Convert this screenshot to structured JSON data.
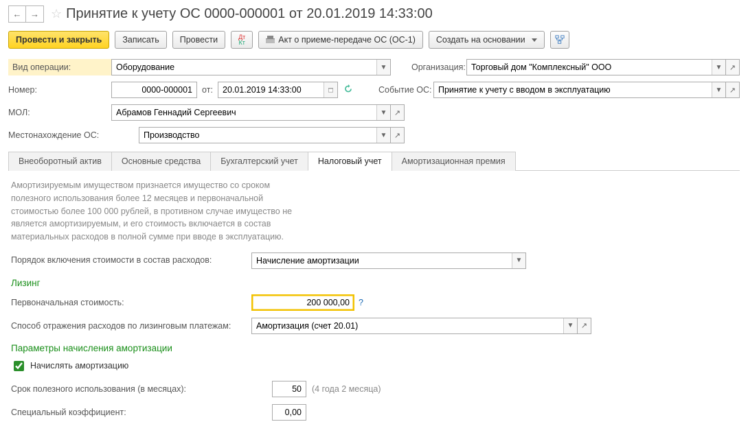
{
  "header": {
    "title": "Принятие к учету ОС 0000-000001 от 20.01.2019 14:33:00"
  },
  "toolbar": {
    "post_close": "Провести и закрыть",
    "save": "Записать",
    "post": "Провести",
    "act": "Акт о приеме-передаче ОС (ОС-1)",
    "create_based": "Создать на основании"
  },
  "form": {
    "op_type_label": "Вид операции:",
    "op_type_value": "Оборудование",
    "org_label": "Организация:",
    "org_value": "Торговый дом \"Комплексный\" ООО",
    "num_label": "Номер:",
    "num_value": "0000-000001",
    "date_label": "от:",
    "date_value": "20.01.2019 14:33:00",
    "event_label": "Событие ОС:",
    "event_value": "Принятие к учету с вводом в эксплуатацию",
    "mol_label": "МОЛ:",
    "mol_value": "Абрамов Геннадий Сергеевич",
    "loc_label": "Местонахождение ОС:",
    "loc_value": "Производство"
  },
  "tabs": {
    "t1": "Внеоборотный актив",
    "t2": "Основные средства",
    "t3": "Бухгалтерский учет",
    "t4": "Налоговый учет",
    "t5": "Амортизационная премия"
  },
  "tax": {
    "info": "Амортизируемым имуществом признается имущество со сроком полезного использования более 12 месяцев и первоначальной стоимостью более 100 000 рублей, в противном случае имущество не является амортизируемым, и его стоимость включается в состав материальных расходов в полной сумме при вводе в эксплуатацию.",
    "order_label": "Порядок включения стоимости в состав расходов:",
    "order_value": "Начисление амортизации",
    "leasing_h": "Лизинг",
    "initcost_label": "Первоначальная стоимость:",
    "initcost_value": "200 000,00",
    "q": "?",
    "expmethod_label": "Способ отражения расходов по лизинговым платежам:",
    "expmethod_value": "Амортизация (счет 20.01)",
    "amort_h": "Параметры начисления амортизации",
    "amort_chk": "Начислять амортизацию",
    "life_label": "Срок полезного использования (в месяцах):",
    "life_value": "50",
    "life_hint": "(4 года 2 месяца)",
    "coef_label": "Специальный коэффициент:",
    "coef_value": "0,00"
  }
}
